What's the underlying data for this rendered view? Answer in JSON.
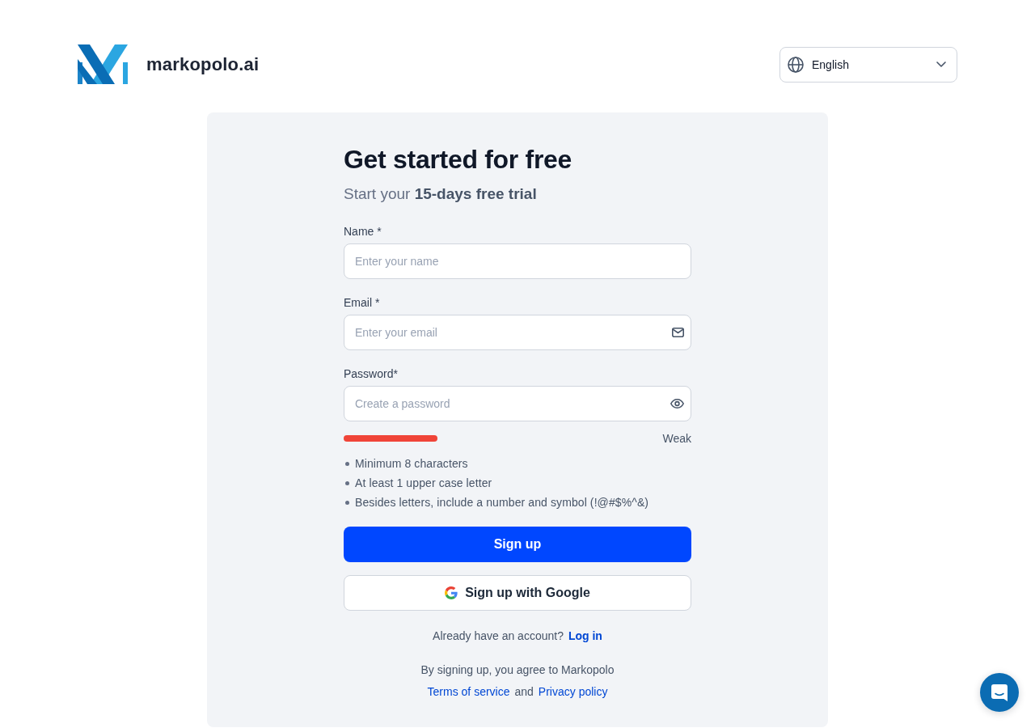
{
  "header": {
    "logo_text": "markopolo.ai",
    "language_select": {
      "value": "English"
    }
  },
  "signup_form": {
    "title": "Get started for free",
    "subtitle": "Start your **15-days free trial**",
    "fields": [
      {
        "kind": "text",
        "label": "Name *",
        "placeholder": "Enter your name"
      },
      {
        "kind": "email",
        "label": "Email *",
        "placeholder": "Enter your email"
      },
      {
        "kind": "password",
        "label": "Password*",
        "placeholder": "Create a password"
      }
    ],
    "password_strength": {
      "level": 0.3,
      "label": "Weak"
    },
    "password_rules": [
      "Minimum 8 characters",
      "At least 1 upper case letter",
      "Besides letters, include a number and symbol (!@#$%^&)"
    ],
    "submit_button": "Sign up",
    "google_button": "Sign up with Google",
    "login_prompt": {
      "text": "Already have an account?",
      "link": "Log in"
    },
    "legal": {
      "text": "By signing up, you agree to Markopolo",
      "terms_link": "Terms of service",
      "conjunction": "and",
      "privacy_link": "Privacy policy"
    }
  }
}
